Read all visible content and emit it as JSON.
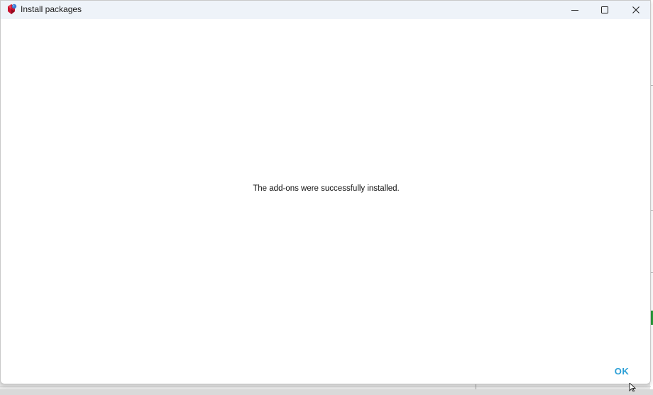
{
  "window": {
    "title": "Install packages",
    "app_icon": "ruby-gem-icon",
    "controls": {
      "minimize_icon": "minimize-icon",
      "maximize_icon": "maximize-icon",
      "close_icon": "close-icon"
    }
  },
  "dialog": {
    "message": "The add-ons were successfully installed.",
    "ok_label": "OK"
  },
  "colors": {
    "accent": "#2a9fd6",
    "titlebar_bg": "#eef3f9",
    "window_bg": "#ffffff",
    "app_icon_red": "#c8102e",
    "app_icon_blue": "#3a7bd5"
  }
}
